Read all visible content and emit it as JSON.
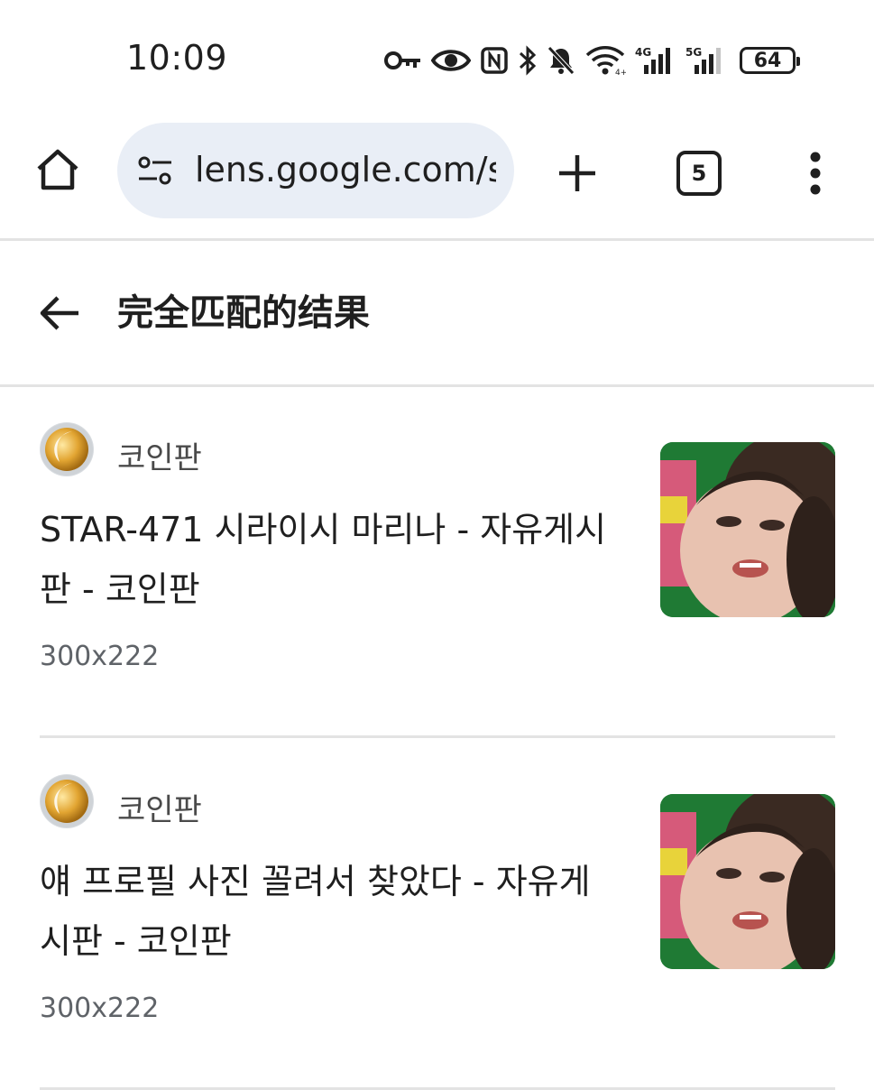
{
  "status_bar": {
    "time": "10:09",
    "icons": [
      "key-icon",
      "eye-icon",
      "nfc-icon",
      "bluetooth-icon",
      "bell-off-icon",
      "wifi-icon",
      "signal-4g-icon",
      "signal-5g-icon"
    ],
    "network_1": "4G",
    "network_2": "5G",
    "battery": "64"
  },
  "toolbar": {
    "url": "lens.google.com/s",
    "tab_count": "5"
  },
  "header": {
    "title": "完全匹配的结果"
  },
  "results": [
    {
      "site": "코인판",
      "title": "STAR-471 시라이시 마리나 - 자유게시판 - 코인판",
      "dims": "300x222"
    },
    {
      "site": "코인판",
      "title": "얘 프로필 사진 꼴려서 찾았다 - 자유게시판 - 코인판",
      "dims": "300x222"
    }
  ],
  "colors": {
    "omnibox_bg": "#e9eef6",
    "divider": "#e3e3e3",
    "text": "#1f1f1f",
    "muted": "#5f6368"
  }
}
